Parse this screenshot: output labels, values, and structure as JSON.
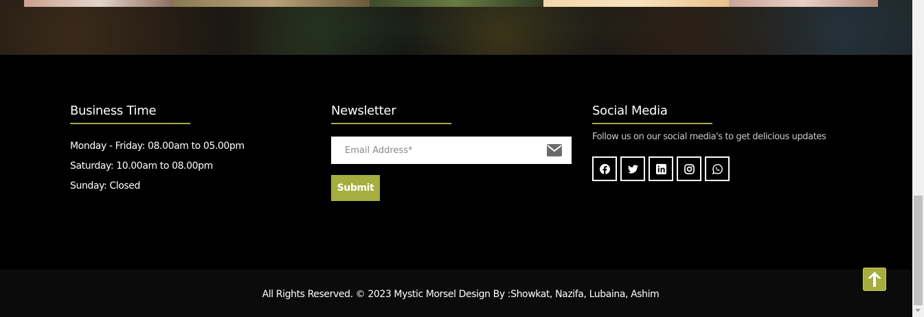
{
  "business": {
    "title": "Business Time",
    "hours": [
      "Monday - Friday: 08.00am to 05.00pm",
      "Saturday: 10.00am to 08.00pm",
      "Sunday: Closed"
    ]
  },
  "newsletter": {
    "title": "Newsletter",
    "email_placeholder": "Email Address*",
    "submit_label": "Submit"
  },
  "social": {
    "title": "Social Media",
    "text": "Follow us on our social media's to get delicious updates",
    "icons": [
      "facebook-icon",
      "twitter-icon",
      "linkedin-icon",
      "instagram-icon",
      "whatsapp-icon"
    ]
  },
  "footer": {
    "copyright": "All Rights Reserved. © 2023 Mystic Morsel Design By :Showkat, Nazifa, Lubaina, Ashim"
  },
  "colors": {
    "accent": "#a5ae3e",
    "background": "#000000",
    "bottom_bar": "#0b0b0b"
  },
  "back_to_top_icon": "arrow-up-icon"
}
